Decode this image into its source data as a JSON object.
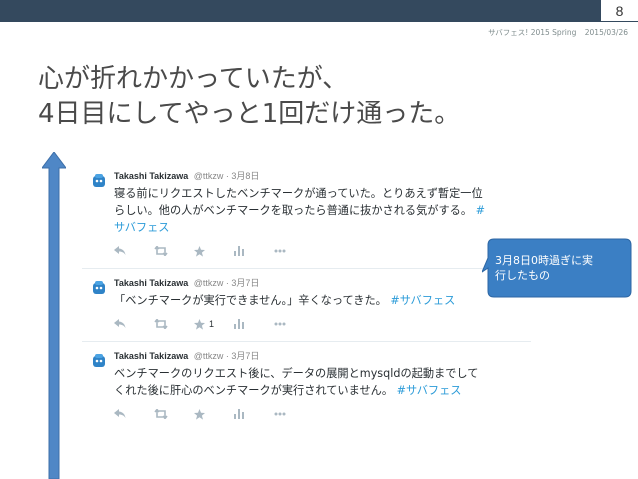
{
  "slide": {
    "page_number": "8",
    "event": "サバフェス! 2015 Spring",
    "date": "2015/03/26",
    "title_line1": "心が折れかかっていたが、",
    "title_line2": "4日目にしてやっと1回だけ通った。"
  },
  "tweets": [
    {
      "name": "Takashi Takizawa",
      "meta": "@ttkzw · 3月8日",
      "text_line1": "寝る前にリクエストしたベンチマークが通っていた。とりあえず暫定一位",
      "text_line2a": "らしい。他の人がベンチマークを取ったら普通に抜かされる気がする。",
      "tag_a": "#",
      "tag_b": "サバフェス",
      "favorites": ""
    },
    {
      "name": "Takashi Takizawa",
      "meta": "@ttkzw · 3月7日",
      "text_line1": "「ベンチマークが実行できません。」辛くなってきた。",
      "tag": "#サバフェス",
      "favorites": "1"
    },
    {
      "name": "Takashi Takizawa",
      "meta": "@ttkzw · 3月7日",
      "text_line1": "ベンチマークのリクエスト後に、データの展開とmysqldの起動までして",
      "text_line2": "くれた後に肝心のベンチマークが実行されていません。",
      "tag": "#サバフェス",
      "favorites": ""
    }
  ],
  "callout": {
    "line1": "3月8日0時過ぎに実",
    "line2": "行したもの"
  },
  "colors": {
    "topbar": "#34495e",
    "callout_fill": "#3b7fc4",
    "arrow_fill": "#4f87c6",
    "hashtag": "#2b9bd8"
  },
  "icons": [
    "reply-icon",
    "retweet-icon",
    "favorite-icon",
    "stats-icon",
    "more-icon",
    "avatar-icon",
    "timeline-up-arrow"
  ]
}
